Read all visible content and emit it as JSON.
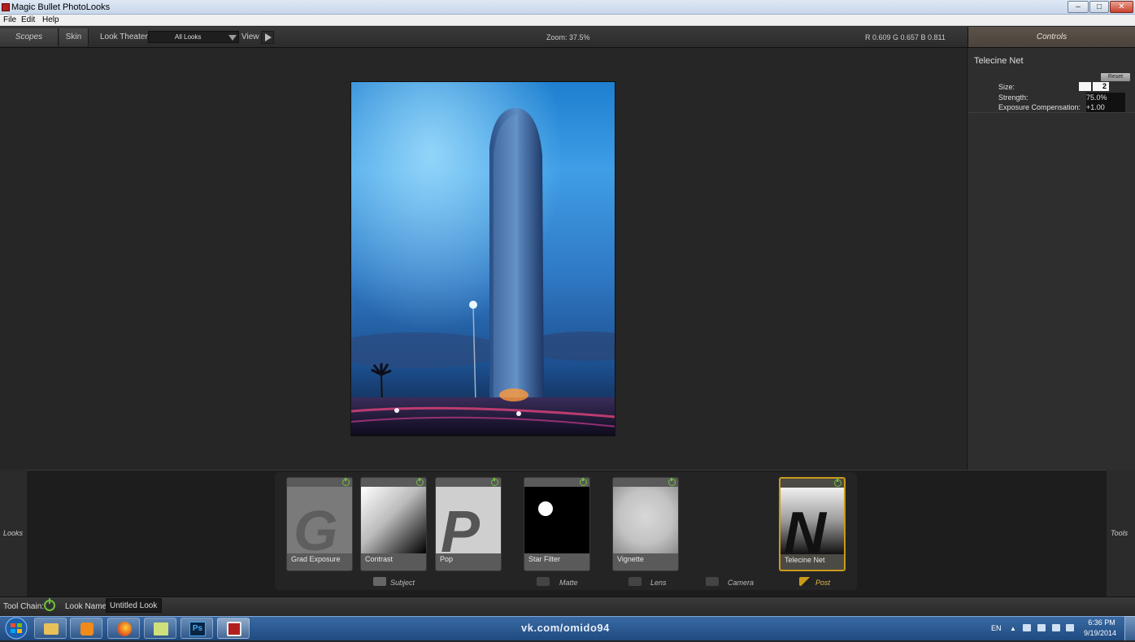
{
  "window": {
    "title": "Magic Bullet PhotoLooks",
    "min": "–",
    "max": "□",
    "close": "✕"
  },
  "menu": {
    "items": [
      "File",
      "Edit",
      "Help"
    ]
  },
  "toolbar": {
    "scopes": "Scopes",
    "skin": "Skin",
    "look_theater": "Look Theater",
    "all_looks": "All Looks",
    "view": "View",
    "zoom": "Zoom:  37.5%",
    "rgb": "R 0.609   G 0.657   B 0.811",
    "controls_tab": "Controls"
  },
  "controls": {
    "effect_title": "Telecine Net",
    "reset": "Reset",
    "params": [
      {
        "label": "Size:",
        "value": "2"
      },
      {
        "label": "Strength:",
        "value": "75.0%"
      },
      {
        "label": "Exposure Compensation:",
        "value": "+1.00"
      }
    ]
  },
  "sides": {
    "looks": "Looks",
    "tools": "Tools"
  },
  "tools": [
    {
      "label": "Grad Exposure",
      "glyph": "G"
    },
    {
      "label": "Contrast"
    },
    {
      "label": "Pop",
      "glyph": "P"
    },
    {
      "label": "Star Filter"
    },
    {
      "label": "Vignette"
    },
    {
      "label": "Telecine Net",
      "glyph": "N"
    }
  ],
  "categories": [
    "Subject",
    "Matte",
    "Lens",
    "Camera",
    "Post"
  ],
  "status": {
    "tool_chain": "Tool Chain:",
    "look_name_label": "Look Name:",
    "look_name_value": "Untitled Look"
  },
  "taskbar": {
    "center_text": "vk.com/omido94",
    "lang": "EN",
    "time": "6:36 PM",
    "date": "9/19/2014"
  },
  "colors": {
    "accent_post": "#c99a1a",
    "power_green": "#6fbf3b",
    "controls_tab": "#4f4740"
  }
}
